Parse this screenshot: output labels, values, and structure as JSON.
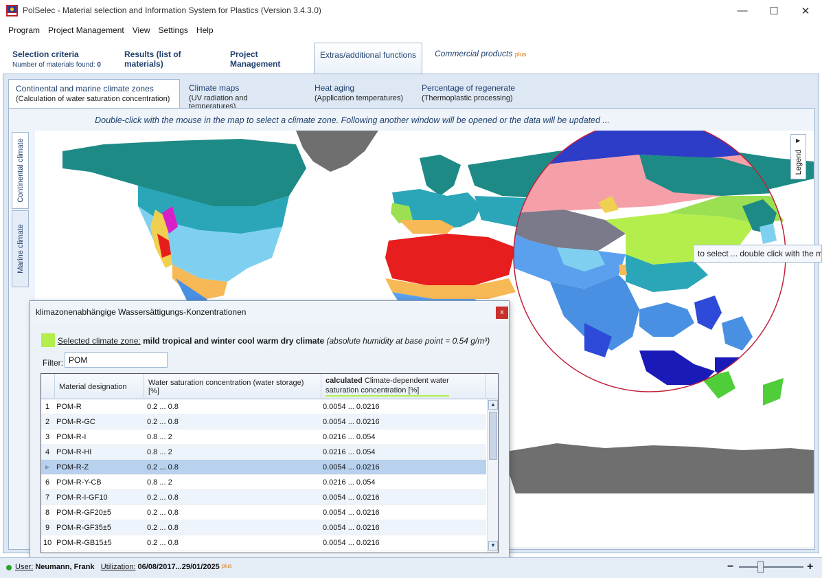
{
  "window": {
    "title": "PolSelec - Material selection and Information System for Plastics (Version 3.4.3.0)",
    "minimize": "—",
    "maximize": "☐",
    "close": "✕"
  },
  "menu": [
    "Program",
    "Project Management",
    "View",
    "Settings",
    "Help"
  ],
  "main_tabs": {
    "selection": "Selection criteria",
    "selection_sub_label": "Number of materials found:",
    "selection_sub_count": "0",
    "results": "Results (list of materials)",
    "project": "Project Management",
    "extras": "Extras/additional functions",
    "commercial": "Commercial products",
    "commercial_tag": "plus"
  },
  "sub_tabs": [
    {
      "title": "Continental and marine climate zones",
      "sub": "(Calculation of water saturation concentration)"
    },
    {
      "title": "Climate maps",
      "sub": "(UV radiation and temperatures)"
    },
    {
      "title": "Heat aging",
      "sub": "(Application temperatures)"
    },
    {
      "title": "Percentage of regenerate",
      "sub": "(Thermoplastic processing)"
    }
  ],
  "hint": "Double-click with the mouse in the map to select a climate zone. Following another window will be opened or the data will be updated ...",
  "vertical_tabs": {
    "continental": "Continental climate",
    "marine": "Marine climate"
  },
  "legend_label": "Legend",
  "legend_arrow": "▶",
  "tooltip": "to select ... double click with the mouse",
  "dialog": {
    "title": "klimazonenabhängige Wassersättigungs-Konzentrationen",
    "close": "x",
    "zone_label": "Selected climate zone:",
    "zone_name": "mild tropical and winter cool warm dry climate",
    "zone_note": "(absolute humidity at base point = 0.54 g/m³)",
    "zone_color": "#b4ee4c",
    "filter_label": "Filter:",
    "filter_value": "POM",
    "columns": {
      "material": "Material designation",
      "water": "Water saturation concentration (water storage) [%]",
      "calc_bold": "calculated",
      "calc_rest": " Climate-dependent water saturation concentration [%]"
    },
    "rows": [
      {
        "n": "1",
        "material": "POM-R",
        "water": "0.2 ... 0.8",
        "calc": "0.0054 ... 0.0216"
      },
      {
        "n": "2",
        "material": "POM-R-GC",
        "water": "0.2 ... 0.8",
        "calc": "0.0054 ... 0.0216"
      },
      {
        "n": "3",
        "material": "POM-R-I",
        "water": "0.8 ... 2",
        "calc": "0.0216 ... 0.054"
      },
      {
        "n": "4",
        "material": "POM-R-HI",
        "water": "0.8 ... 2",
        "calc": "0.0216 ... 0.054"
      },
      {
        "n": "",
        "material": "POM-R-Z",
        "water": "0.2 ... 0.8",
        "calc": "0.0054 ... 0.0216"
      },
      {
        "n": "6",
        "material": "POM-R-Y-CB",
        "water": "0.8 ... 2",
        "calc": "0.0216 ... 0.054"
      },
      {
        "n": "7",
        "material": "POM-R-I-GF10",
        "water": "0.2 ... 0.8",
        "calc": "0.0054 ... 0.0216"
      },
      {
        "n": "8",
        "material": "POM-R-GF20±5",
        "water": "0.2 ... 0.8",
        "calc": "0.0054 ... 0.0216"
      },
      {
        "n": "9",
        "material": "POM-R-GF35±5",
        "water": "0.2 ... 0.8",
        "calc": "0.0054 ... 0.0216"
      },
      {
        "n": "10",
        "material": "POM-R-GB15±5",
        "water": "0.2 ... 0.8",
        "calc": "0.0054 ... 0.0216"
      }
    ],
    "selected_row": 4,
    "scroll_up": "▲",
    "scroll_down": "▼"
  },
  "status": {
    "user_label": "User:",
    "user": "Neumann, Frank",
    "util_label": "Utilization:",
    "util": "06/08/2017...29/01/2025",
    "util_tag": "plus",
    "zoom_minus": "−",
    "zoom_plus": "+"
  }
}
